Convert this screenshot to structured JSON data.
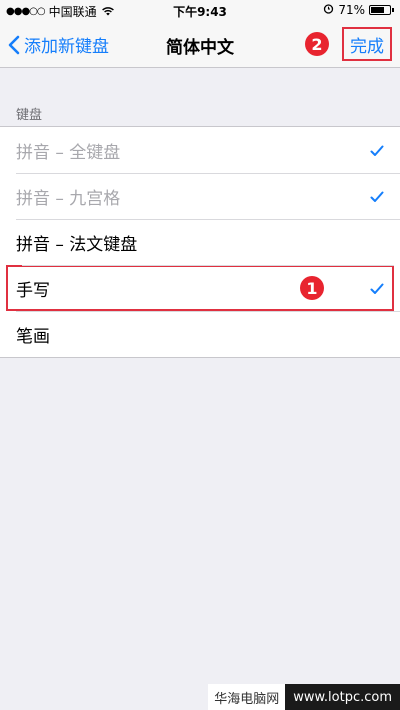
{
  "status_bar": {
    "signal": "●●●○○",
    "carrier": "中国联通",
    "time": "下午9:43",
    "battery": "71%",
    "battery_level": 0.71
  },
  "nav": {
    "back_label": "添加新键盘",
    "title": "简体中文",
    "done_label": "完成"
  },
  "annotations": {
    "step1": "1",
    "step2": "2"
  },
  "section": {
    "header": "键盘",
    "rows": [
      {
        "label": "拼音 – 全键盘",
        "checked": true,
        "disabled": true
      },
      {
        "label": "拼音 – 九宫格",
        "checked": true,
        "disabled": true
      },
      {
        "label": "拼音 – 法文键盘",
        "checked": false,
        "disabled": false
      },
      {
        "label": "手写",
        "checked": true,
        "disabled": false
      },
      {
        "label": "笔画",
        "checked": false,
        "disabled": false
      }
    ]
  },
  "watermark": {
    "cn": "华海电脑网",
    "url": "www.lotpc.com"
  },
  "colors": {
    "accent": "#157efb",
    "highlight": "#e03040",
    "badge": "#e8242f"
  }
}
